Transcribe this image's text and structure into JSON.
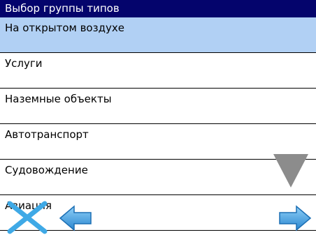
{
  "window": {
    "title": "Выбор группы типов"
  },
  "list": {
    "items": [
      {
        "label": "На открытом воздухе",
        "selected": true
      },
      {
        "label": "Услуги",
        "selected": false
      },
      {
        "label": "Наземные объекты",
        "selected": false
      },
      {
        "label": "Автотранспорт",
        "selected": false
      },
      {
        "label": "Судовождение",
        "selected": false
      },
      {
        "label": "Авиация",
        "selected": false
      }
    ]
  },
  "colors": {
    "title_bar": "#04046c",
    "selected_row": "#b1d0f4",
    "arrow_blue": "#3fa9e6",
    "scroll_arrow_gray": "#8c8c8c"
  },
  "icons": {
    "close": "close-icon",
    "back": "arrow-left-icon",
    "forward": "arrow-right-icon",
    "scroll_down": "scroll-down-icon"
  }
}
